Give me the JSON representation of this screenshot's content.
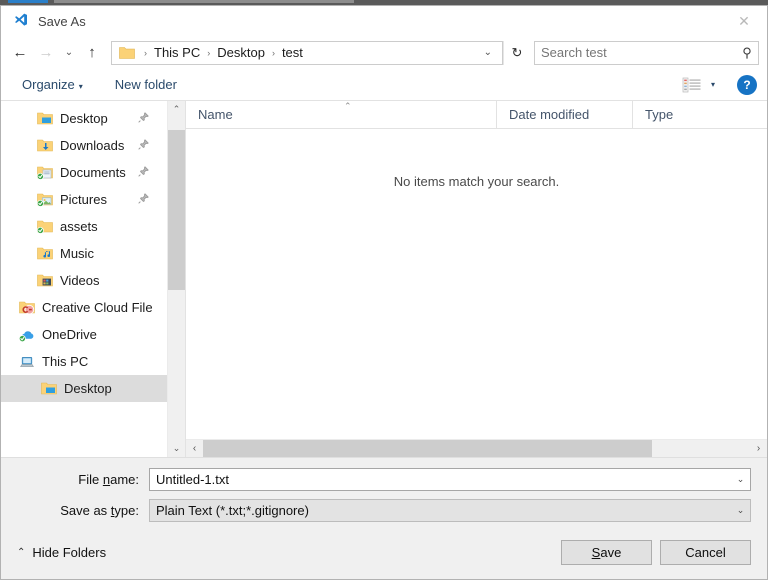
{
  "window": {
    "title": "Save As",
    "app_icon": "vscode-icon",
    "close_label": "✕"
  },
  "nav": {
    "back_icon": "←",
    "forward_icon": "→",
    "recent_icon": "⌄",
    "up_icon": "↑",
    "breadcrumb": [
      "This PC",
      "Desktop",
      "test"
    ],
    "separator": "›",
    "address_chevron": "⌄",
    "refresh_icon": "↻"
  },
  "search": {
    "placeholder": "Search test",
    "value": "",
    "icon": "⚲"
  },
  "toolbar": {
    "organize_label": "Organize",
    "organize_caret": "▾",
    "new_folder_label": "New folder",
    "view_caret": "▾",
    "help_label": "?"
  },
  "sidebar": {
    "items": [
      {
        "label": "Desktop",
        "icon": "folder-desktop-icon",
        "pinned": true,
        "pin": "📌",
        "indent": 1,
        "selected": false,
        "badge": false
      },
      {
        "label": "Downloads",
        "icon": "folder-downloads-icon",
        "pinned": true,
        "pin": "📌",
        "indent": 1,
        "selected": false,
        "badge": false
      },
      {
        "label": "Documents",
        "icon": "folder-documents-icon",
        "pinned": true,
        "pin": "📌",
        "indent": 1,
        "selected": false,
        "badge": true
      },
      {
        "label": "Pictures",
        "icon": "folder-pictures-icon",
        "pinned": true,
        "pin": "📌",
        "indent": 1,
        "selected": false,
        "badge": true
      },
      {
        "label": "assets",
        "icon": "folder-icon",
        "pinned": false,
        "pin": "",
        "indent": 1,
        "selected": false,
        "badge": true
      },
      {
        "label": "Music",
        "icon": "folder-music-icon",
        "pinned": false,
        "pin": "",
        "indent": 1,
        "selected": false,
        "badge": false
      },
      {
        "label": "Videos",
        "icon": "folder-videos-icon",
        "pinned": false,
        "pin": "",
        "indent": 1,
        "selected": false,
        "badge": false
      },
      {
        "label": "Creative Cloud File",
        "icon": "creative-cloud-icon",
        "pinned": false,
        "pin": "",
        "indent": 0,
        "selected": false,
        "badge": false
      },
      {
        "label": "OneDrive",
        "icon": "onedrive-icon",
        "pinned": false,
        "pin": "",
        "indent": 0,
        "selected": false,
        "badge": true
      },
      {
        "label": "This PC",
        "icon": "this-pc-icon",
        "pinned": false,
        "pin": "",
        "indent": 0,
        "selected": false,
        "badge": false
      },
      {
        "label": "Desktop",
        "icon": "folder-desktop-icon",
        "pinned": false,
        "pin": "",
        "indent": 2,
        "selected": true,
        "badge": false
      }
    ],
    "scroll_up": "⌃",
    "scroll_down": "⌄"
  },
  "filelist": {
    "columns": [
      {
        "label": "Name"
      },
      {
        "label": "Date modified"
      },
      {
        "label": "Type"
      }
    ],
    "sort_caret": "⌃",
    "empty_message": "No items match your search.",
    "rows": [],
    "scroll_left": "‹",
    "scroll_right": "›"
  },
  "form": {
    "filename": {
      "label_before": "File ",
      "label_accel": "n",
      "label_after": "ame:",
      "value": "Untitled-1.txt",
      "drop_icon": "⌄"
    },
    "filetype": {
      "label_before": "Save as ",
      "label_accel": "t",
      "label_after": "ype:",
      "value": "Plain Text (*.txt;*.gitignore)",
      "drop_icon": "⌄"
    }
  },
  "footer": {
    "hide_folders_label": "Hide Folders",
    "hide_folders_chevron": "⌃",
    "save_before": "",
    "save_accel": "S",
    "save_after": "ave",
    "cancel_label": "Cancel"
  },
  "colors": {
    "accent_blue": "#1673c4",
    "folder_yellow": "#ffcc66",
    "selection_gray": "#dcdcdc",
    "dialog_bg": "#f0f0f0",
    "crumb_text": "#1c1c1c"
  }
}
